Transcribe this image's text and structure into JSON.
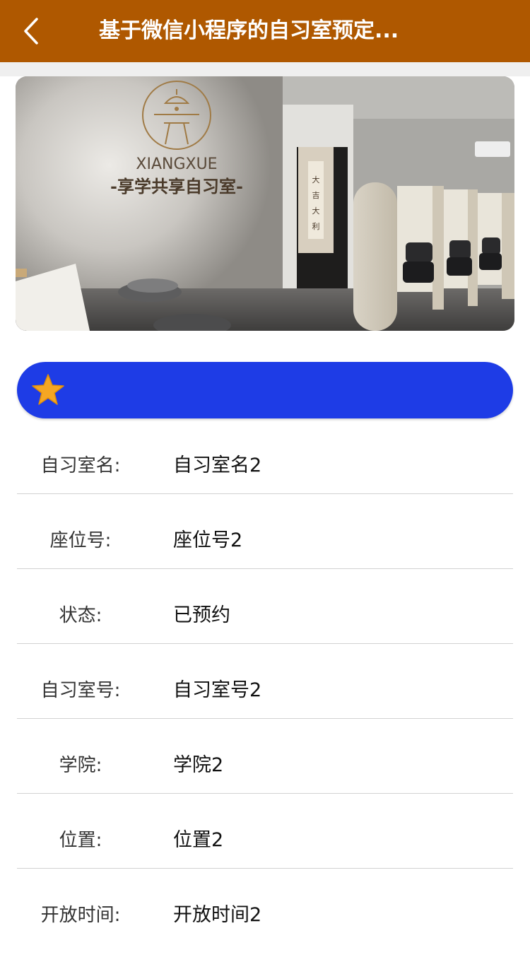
{
  "header": {
    "back_icon": "chevron-left-icon",
    "title": "基于微信小程序的自习室预定..."
  },
  "banner": {
    "logo_text": "XIANGXUE",
    "logo_subtitle": "-享学共享自习室-",
    "curtain_text": "大吉大利"
  },
  "section": {
    "icon": "star-icon",
    "star_color": "#f5a623",
    "bar_color": "#1e3ce6"
  },
  "details": [
    {
      "label": "自习室名:",
      "value": "自习室名2"
    },
    {
      "label": "座位号:",
      "value": "座位号2"
    },
    {
      "label": "状态:",
      "value": "已预约"
    },
    {
      "label": "自习室号:",
      "value": "自习室号2"
    },
    {
      "label": "学院:",
      "value": "学院2"
    },
    {
      "label": "位置:",
      "value": "位置2"
    },
    {
      "label": "开放时间:",
      "value": "开放时间2"
    }
  ],
  "colors": {
    "header_bg": "#af5800",
    "divider": "#d2d2d2"
  }
}
